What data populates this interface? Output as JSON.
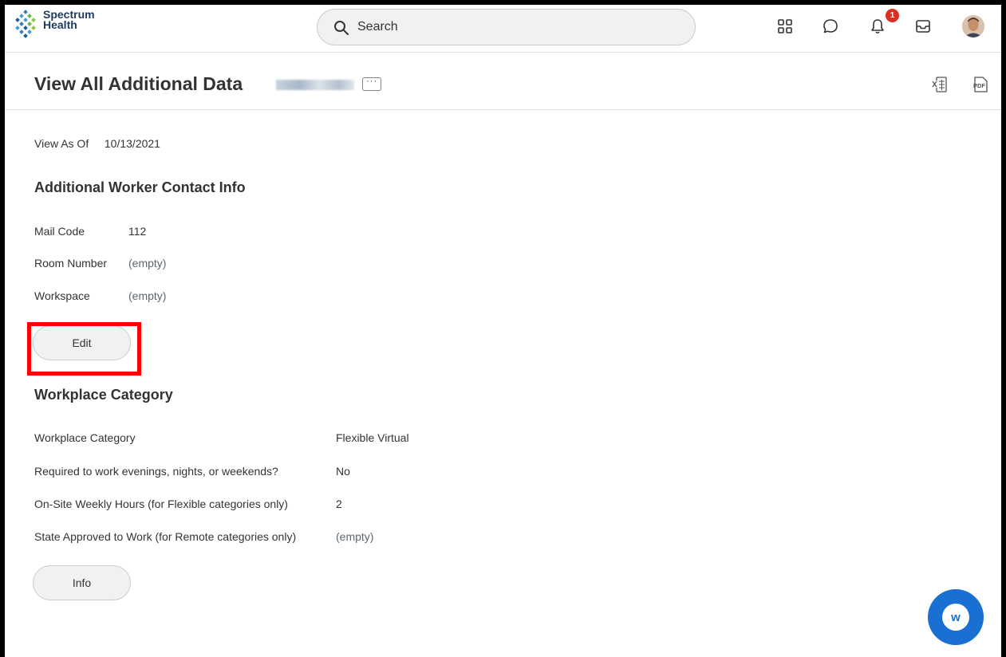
{
  "brand": {
    "line1": "Spectrum",
    "line2": "Health"
  },
  "search": {
    "placeholder": "Search"
  },
  "notifications": {
    "count": "1"
  },
  "header": {
    "title": "View All Additional Data",
    "related_actions": "···"
  },
  "view_as": {
    "label": "View As Of",
    "value": "10/13/2021"
  },
  "contact_section": {
    "title": "Additional Worker Contact Info",
    "fields": [
      {
        "label": "Mail Code",
        "value": "112"
      },
      {
        "label": "Room Number",
        "value": "(empty)"
      },
      {
        "label": "Workspace",
        "value": "(empty)"
      }
    ],
    "edit_label": "Edit"
  },
  "workplace_section": {
    "title": "Workplace Category",
    "fields": [
      {
        "label": "Workplace Category",
        "value": "Flexible Virtual"
      },
      {
        "label": "Required to work evenings, nights, or weekends?",
        "value": "No"
      },
      {
        "label": "On-Site Weekly Hours (for Flexible categories only)",
        "value": "2"
      },
      {
        "label": "State Approved to Work (for Remote categories only)",
        "value": "(empty)"
      }
    ],
    "info_label": "Info"
  },
  "assistant": {
    "letter": "w"
  },
  "colors": {
    "accent": "#1a6fd3",
    "badge": "#de2e21",
    "highlight": "#ff0000"
  }
}
